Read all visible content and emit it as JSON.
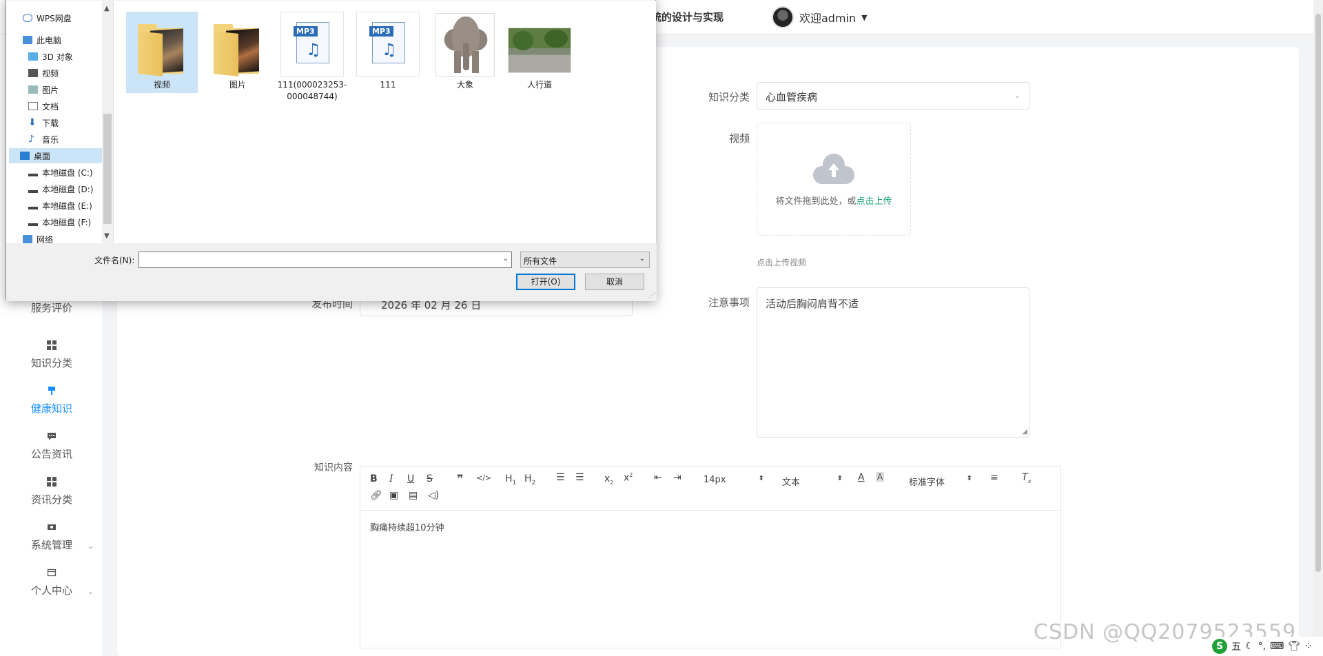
{
  "header": {
    "system_title": "统的设计与实现",
    "welcome": "欢迎admin"
  },
  "sidebar": {
    "items": [
      {
        "label": "服务评价",
        "icon": "grid-icon"
      },
      {
        "label": "知识分类",
        "icon": "grid-icon"
      },
      {
        "label": "健康知识",
        "icon": "pin-icon",
        "active": true
      },
      {
        "label": "公告资讯",
        "icon": "chat-icon"
      },
      {
        "label": "资讯分类",
        "icon": "grid-icon"
      },
      {
        "label": "系统管理",
        "icon": "ticket-icon",
        "expandable": true
      },
      {
        "label": "个人中心",
        "icon": "card-icon",
        "expandable": true
      }
    ]
  },
  "form": {
    "category_label": "知识分类",
    "category_value": "心血管疾病",
    "video_label": "视频",
    "upload_text": "将文件拖到此处，或",
    "upload_link": "点击上传",
    "upload_tip": "点击上传视频",
    "publish_label": "发布时间",
    "publish_value": "2026 年 02 月 26 日",
    "notes_label": "注意事项",
    "notes_value": "活动后胸闷肩背不适",
    "content_label": "知识内容",
    "content_value": "胸痛持续超10分钟"
  },
  "editor": {
    "font_size": "14px",
    "block_type": "文本",
    "font_family": "标准字体"
  },
  "dialog": {
    "tree": [
      {
        "label": "WPS网盘",
        "icon": "cloud-icon"
      },
      {
        "label": "此电脑",
        "icon": "computer-icon"
      },
      {
        "label": "3D 对象",
        "icon": "cube-icon"
      },
      {
        "label": "视频",
        "icon": "video-icon"
      },
      {
        "label": "图片",
        "icon": "image-icon"
      },
      {
        "label": "文档",
        "icon": "document-icon"
      },
      {
        "label": "下载",
        "icon": "download-icon"
      },
      {
        "label": "音乐",
        "icon": "music-icon"
      },
      {
        "label": "桌面",
        "icon": "desktop-icon",
        "selected": true
      },
      {
        "label": "本地磁盘 (C:)",
        "icon": "drive-icon"
      },
      {
        "label": "本地磁盘 (D:)",
        "icon": "drive-icon"
      },
      {
        "label": "本地磁盘 (E:)",
        "icon": "drive-icon"
      },
      {
        "label": "本地磁盘 (F:)",
        "icon": "drive-icon"
      },
      {
        "label": "网络",
        "icon": "network-icon"
      }
    ],
    "files": [
      {
        "name": "视频",
        "kind": "folder",
        "selected": true
      },
      {
        "name": "图片",
        "kind": "folder"
      },
      {
        "name": "111(000023253-000048744)",
        "kind": "mp3"
      },
      {
        "name": "111",
        "kind": "mp3"
      },
      {
        "name": "大象",
        "kind": "image"
      },
      {
        "name": "人行道",
        "kind": "image"
      }
    ],
    "filename_label": "文件名(N):",
    "filename_value": "",
    "filetype_value": "所有文件",
    "open_button": "打开(O)",
    "cancel_button": "取消"
  },
  "watermark": "CSDN @QQ2079523559",
  "tray": {
    "ime": "五"
  },
  "colors": {
    "accent": "#1890ff",
    "link": "#1aa37a",
    "selection": "#cce4f7"
  }
}
